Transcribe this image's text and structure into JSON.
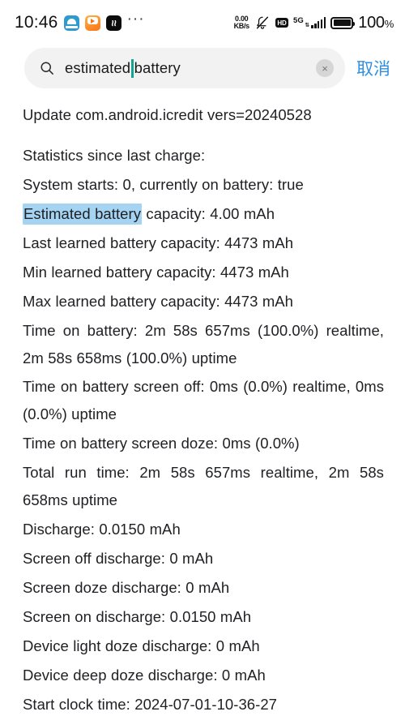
{
  "status_bar": {
    "clock": "10:46",
    "notification_icons": [
      "cloud-app-icon",
      "video-app-icon",
      "capcut-app-icon"
    ],
    "overflow": "···",
    "net_speed_value": "0.00",
    "net_speed_unit": "KB/s",
    "mute_icon": "ringer-off-icon",
    "hd_badge": "HD",
    "network_type": "5G",
    "signal_updown": "⇅",
    "battery_percent": "100",
    "battery_percent_symbol": "%"
  },
  "search": {
    "icon": "search-icon",
    "value_before_caret": "estimated",
    "value_after_caret": "battery",
    "full_value": "estimated battery",
    "clear_label": "×",
    "cancel_label": "取消"
  },
  "content": {
    "lines": [
      "Update com.android.icredit vers=20240528",
      "Statistics since last charge:",
      "System starts: 0, currently on battery: true",
      "Estimated battery capacity: 4.00 mAh",
      "Last learned battery capacity: 4473 mAh",
      "Min learned battery capacity: 4473 mAh",
      "Max learned battery capacity: 4473 mAh",
      "Time on battery: 2m 58s 657ms (100.0%) realtime, 2m 58s 658ms (100.0%) uptime",
      "Time on battery screen off: 0ms (0.0%) realtime, 0ms (0.0%) uptime",
      "Time on battery screen doze: 0ms (0.0%)",
      "Total run time: 2m 58s 657ms realtime, 2m 58s 658ms uptime",
      "Discharge: 0.0150 mAh",
      "Screen off discharge: 0 mAh",
      "Screen doze discharge: 0 mAh",
      "Screen on discharge: 0.0150 mAh",
      "Device light doze discharge: 0 mAh",
      "Device deep doze discharge: 0 mAh",
      "Start clock time: 2024-07-01-10-36-27"
    ],
    "highlight_text": "Estimated battery",
    "highlight_rest": " capacity: 4.00 mAh",
    "highlight_color": "#a5d4f2"
  }
}
